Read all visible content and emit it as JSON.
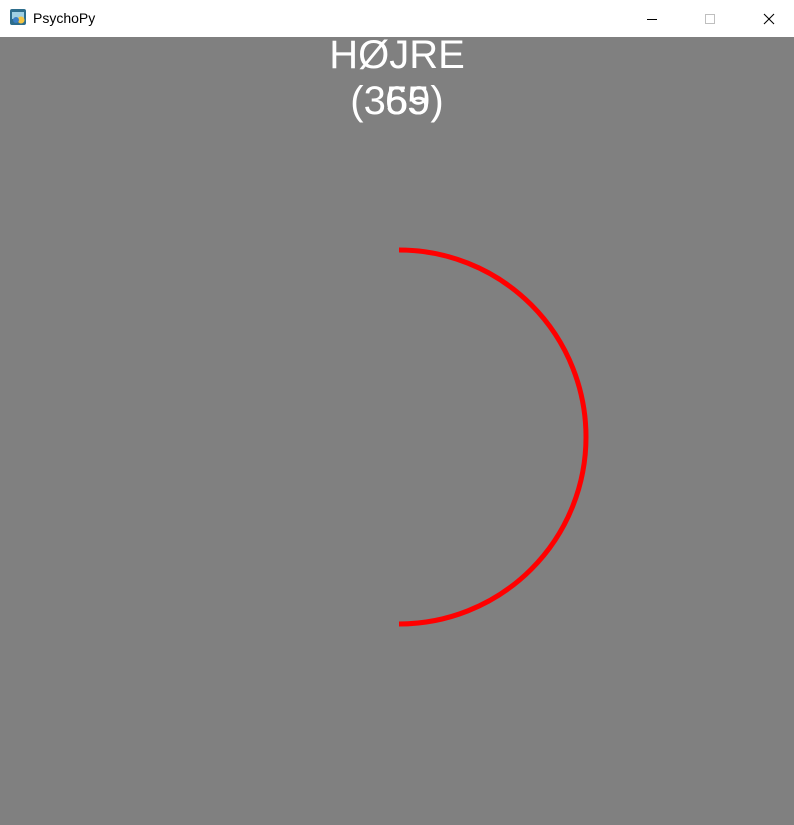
{
  "window": {
    "title": "PsychoPy",
    "icon": "psychopy-icon",
    "controls": [
      "minimize-icon",
      "maximize-icon",
      "close-icon"
    ]
  },
  "stimulus": {
    "direction_label": "HØJRE",
    "counter_text": "(359)",
    "overlap_digits": "65",
    "arc_color": "#ff0000",
    "background_color": "#808080"
  }
}
